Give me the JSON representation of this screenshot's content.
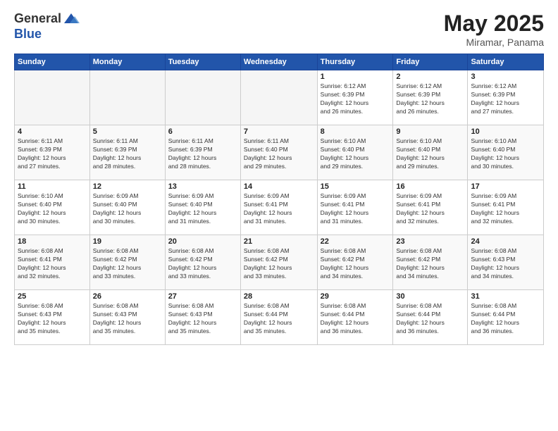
{
  "logo": {
    "general": "General",
    "blue": "Blue"
  },
  "header": {
    "month": "May 2025",
    "location": "Miramar, Panama"
  },
  "weekdays": [
    "Sunday",
    "Monday",
    "Tuesday",
    "Wednesday",
    "Thursday",
    "Friday",
    "Saturday"
  ],
  "weeks": [
    [
      {
        "day": "",
        "info": ""
      },
      {
        "day": "",
        "info": ""
      },
      {
        "day": "",
        "info": ""
      },
      {
        "day": "",
        "info": ""
      },
      {
        "day": "1",
        "info": "Sunrise: 6:12 AM\nSunset: 6:39 PM\nDaylight: 12 hours\nand 26 minutes."
      },
      {
        "day": "2",
        "info": "Sunrise: 6:12 AM\nSunset: 6:39 PM\nDaylight: 12 hours\nand 26 minutes."
      },
      {
        "day": "3",
        "info": "Sunrise: 6:12 AM\nSunset: 6:39 PM\nDaylight: 12 hours\nand 27 minutes."
      }
    ],
    [
      {
        "day": "4",
        "info": "Sunrise: 6:11 AM\nSunset: 6:39 PM\nDaylight: 12 hours\nand 27 minutes."
      },
      {
        "day": "5",
        "info": "Sunrise: 6:11 AM\nSunset: 6:39 PM\nDaylight: 12 hours\nand 28 minutes."
      },
      {
        "day": "6",
        "info": "Sunrise: 6:11 AM\nSunset: 6:39 PM\nDaylight: 12 hours\nand 28 minutes."
      },
      {
        "day": "7",
        "info": "Sunrise: 6:11 AM\nSunset: 6:40 PM\nDaylight: 12 hours\nand 29 minutes."
      },
      {
        "day": "8",
        "info": "Sunrise: 6:10 AM\nSunset: 6:40 PM\nDaylight: 12 hours\nand 29 minutes."
      },
      {
        "day": "9",
        "info": "Sunrise: 6:10 AM\nSunset: 6:40 PM\nDaylight: 12 hours\nand 29 minutes."
      },
      {
        "day": "10",
        "info": "Sunrise: 6:10 AM\nSunset: 6:40 PM\nDaylight: 12 hours\nand 30 minutes."
      }
    ],
    [
      {
        "day": "11",
        "info": "Sunrise: 6:10 AM\nSunset: 6:40 PM\nDaylight: 12 hours\nand 30 minutes."
      },
      {
        "day": "12",
        "info": "Sunrise: 6:09 AM\nSunset: 6:40 PM\nDaylight: 12 hours\nand 30 minutes."
      },
      {
        "day": "13",
        "info": "Sunrise: 6:09 AM\nSunset: 6:40 PM\nDaylight: 12 hours\nand 31 minutes."
      },
      {
        "day": "14",
        "info": "Sunrise: 6:09 AM\nSunset: 6:41 PM\nDaylight: 12 hours\nand 31 minutes."
      },
      {
        "day": "15",
        "info": "Sunrise: 6:09 AM\nSunset: 6:41 PM\nDaylight: 12 hours\nand 31 minutes."
      },
      {
        "day": "16",
        "info": "Sunrise: 6:09 AM\nSunset: 6:41 PM\nDaylight: 12 hours\nand 32 minutes."
      },
      {
        "day": "17",
        "info": "Sunrise: 6:09 AM\nSunset: 6:41 PM\nDaylight: 12 hours\nand 32 minutes."
      }
    ],
    [
      {
        "day": "18",
        "info": "Sunrise: 6:08 AM\nSunset: 6:41 PM\nDaylight: 12 hours\nand 32 minutes."
      },
      {
        "day": "19",
        "info": "Sunrise: 6:08 AM\nSunset: 6:42 PM\nDaylight: 12 hours\nand 33 minutes."
      },
      {
        "day": "20",
        "info": "Sunrise: 6:08 AM\nSunset: 6:42 PM\nDaylight: 12 hours\nand 33 minutes."
      },
      {
        "day": "21",
        "info": "Sunrise: 6:08 AM\nSunset: 6:42 PM\nDaylight: 12 hours\nand 33 minutes."
      },
      {
        "day": "22",
        "info": "Sunrise: 6:08 AM\nSunset: 6:42 PM\nDaylight: 12 hours\nand 34 minutes."
      },
      {
        "day": "23",
        "info": "Sunrise: 6:08 AM\nSunset: 6:42 PM\nDaylight: 12 hours\nand 34 minutes."
      },
      {
        "day": "24",
        "info": "Sunrise: 6:08 AM\nSunset: 6:43 PM\nDaylight: 12 hours\nand 34 minutes."
      }
    ],
    [
      {
        "day": "25",
        "info": "Sunrise: 6:08 AM\nSunset: 6:43 PM\nDaylight: 12 hours\nand 35 minutes."
      },
      {
        "day": "26",
        "info": "Sunrise: 6:08 AM\nSunset: 6:43 PM\nDaylight: 12 hours\nand 35 minutes."
      },
      {
        "day": "27",
        "info": "Sunrise: 6:08 AM\nSunset: 6:43 PM\nDaylight: 12 hours\nand 35 minutes."
      },
      {
        "day": "28",
        "info": "Sunrise: 6:08 AM\nSunset: 6:44 PM\nDaylight: 12 hours\nand 35 minutes."
      },
      {
        "day": "29",
        "info": "Sunrise: 6:08 AM\nSunset: 6:44 PM\nDaylight: 12 hours\nand 36 minutes."
      },
      {
        "day": "30",
        "info": "Sunrise: 6:08 AM\nSunset: 6:44 PM\nDaylight: 12 hours\nand 36 minutes."
      },
      {
        "day": "31",
        "info": "Sunrise: 6:08 AM\nSunset: 6:44 PM\nDaylight: 12 hours\nand 36 minutes."
      }
    ]
  ]
}
